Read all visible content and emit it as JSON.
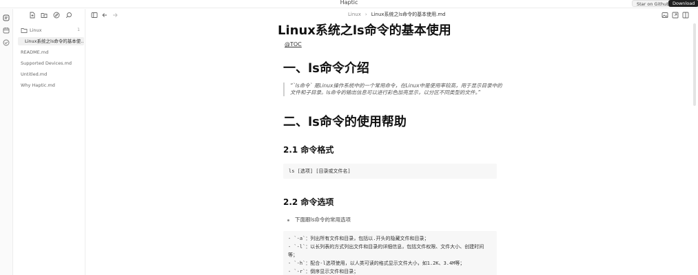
{
  "window": {
    "title": "Haptic",
    "github_label": "Star on Github",
    "download_label": "Download"
  },
  "activity_bar": {
    "items": [
      {
        "icon": "notes-icon"
      },
      {
        "icon": "calendar-icon"
      },
      {
        "icon": "check-circle-icon"
      }
    ]
  },
  "sidebar": {
    "toolbar": [
      {
        "icon": "new-file-icon"
      },
      {
        "icon": "new-folder-icon"
      },
      {
        "icon": "compass-icon"
      },
      {
        "icon": "search-icon"
      }
    ],
    "folder": {
      "name": "Linux",
      "count": "1",
      "files": [
        {
          "name": "Linux系统之ls命令的基本使..."
        }
      ]
    },
    "files": [
      {
        "name": "README.md"
      },
      {
        "name": "Supported Devices.md"
      },
      {
        "name": "Untitled.md"
      },
      {
        "name": "Why Haptic.md"
      }
    ]
  },
  "editor": {
    "breadcrumb": {
      "folder": "Linux",
      "separator": "›",
      "file": "Linux系统之ls命令的基本使用.md"
    }
  },
  "document": {
    "title": "Linux系统之ls命令的基本使用",
    "toc": "@TOC",
    "section1": "一、ls命令介绍",
    "quote": "“`ls命令` 是Linux操作系统中的一个常用命令，在Linux中是使用率较高，用于显示目录中的文件和子目录。ls命令的输出信息可以进行彩色加亮显示，以分区不同类型的文件。”",
    "section2": "二、ls命令的使用帮助",
    "sub1": "2.1 命令格式",
    "code1": "ls [选项] [目录或文件名]",
    "sub2": "2.2 命令选项",
    "bullet": "下面跟ls命令的常用选项",
    "code2": [
      "- `-a`：列出所有文件和目录，包括以.开头的隐藏文件和目录；",
      "- `-l`：以长列表的方式列出文件和目录的详细信息，包括文件权限、文件大小、创建时间",
      "等；",
      "- `-h`：配合-l选项使用，以人类可读的格式显示文件大小，如1.2K、3.4M等；",
      "- `-r`：倒序显示文件和目录；"
    ]
  }
}
